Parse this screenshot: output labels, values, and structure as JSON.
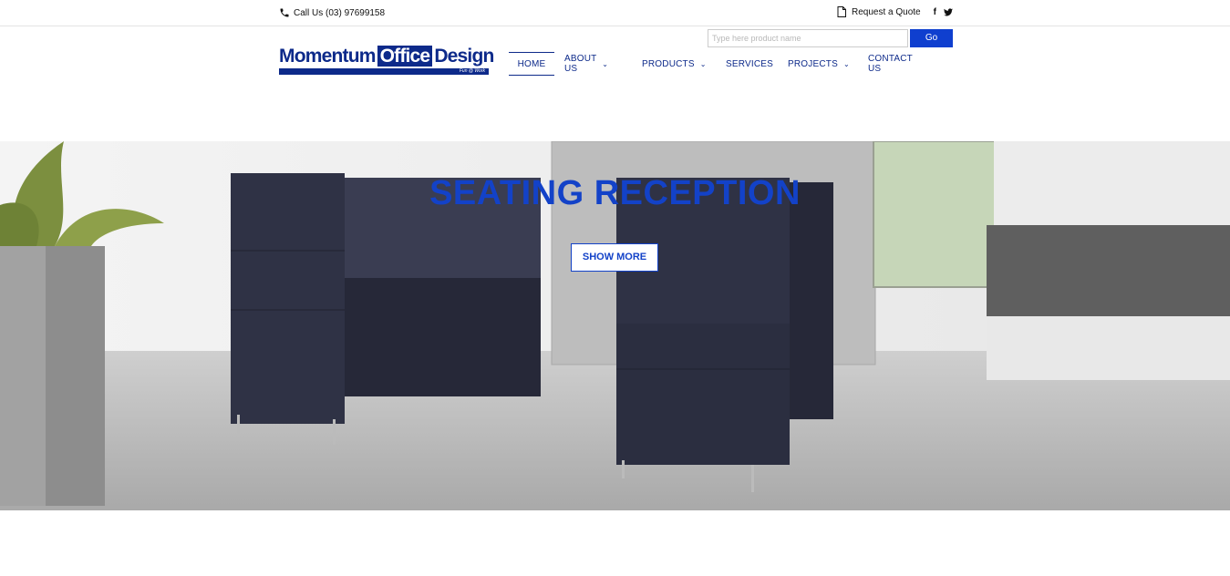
{
  "topbar": {
    "phone_icon": "phone-icon",
    "call_text": "Call Us (03) 97699158",
    "quote_icon": "document-icon",
    "quote_text": "Request a Quote",
    "facebook": "f",
    "twitter_icon": "twitter-icon"
  },
  "logo": {
    "word1": "Momentum",
    "word2": "Office",
    "word3": "Design",
    "tagline": "Fun @ Work"
  },
  "search": {
    "placeholder": "Type here product name",
    "button_label": "Go"
  },
  "nav": {
    "home": "HOME",
    "about": "ABOUT US",
    "products": "PRODUCTS",
    "services": "SERVICES",
    "projects": "PROJECTS",
    "contact": "CONTACT US",
    "chevron": "⌄"
  },
  "hero": {
    "title": "SEATING RECEPTION",
    "button_label": "SHOW MORE"
  },
  "colors": {
    "brand_blue": "#0d2a8a",
    "accent_blue": "#1342c8",
    "go_button": "#0f3fcf"
  }
}
